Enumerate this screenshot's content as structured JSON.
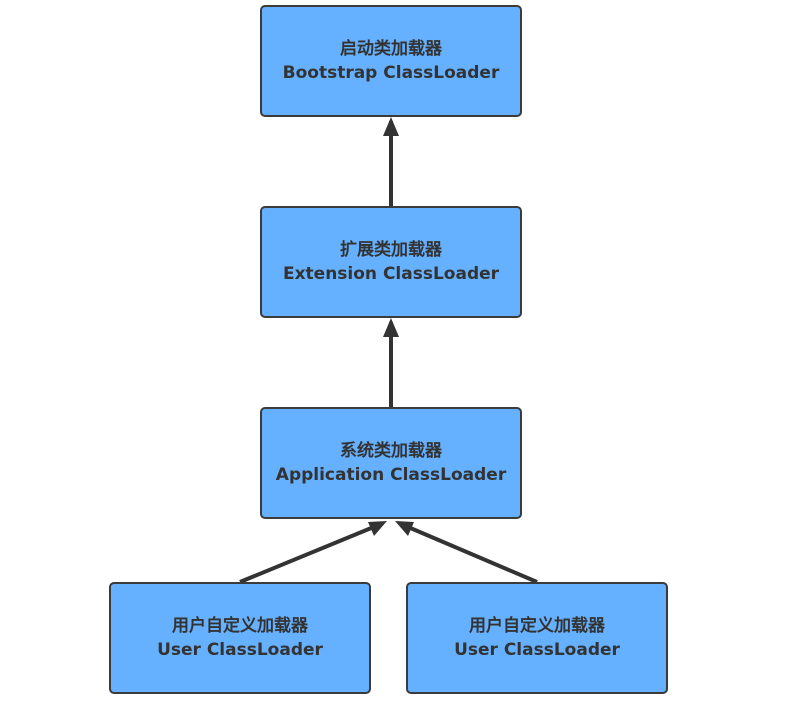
{
  "nodes": {
    "bootstrap": {
      "title": "启动类加载器",
      "subtitle": "Bootstrap ClassLoader"
    },
    "extension": {
      "title": "扩展类加载器",
      "subtitle": "Extension ClassLoader"
    },
    "application": {
      "title": "系统类加载器",
      "subtitle": "Application ClassLoader"
    },
    "user_1": {
      "title": "用户自定义加载器",
      "subtitle": "User ClassLoader"
    },
    "user_2": {
      "title": "用户自定义加载器",
      "subtitle": "User ClassLoader"
    }
  },
  "edges": [
    {
      "from": "extension",
      "to": "bootstrap"
    },
    {
      "from": "application",
      "to": "extension"
    },
    {
      "from": "user_1",
      "to": "application"
    },
    {
      "from": "user_2",
      "to": "application"
    }
  ],
  "colors": {
    "node_fill": "#66b1ff",
    "node_border": "#3b3b3b",
    "text": "#333333",
    "arrow": "#333333"
  }
}
